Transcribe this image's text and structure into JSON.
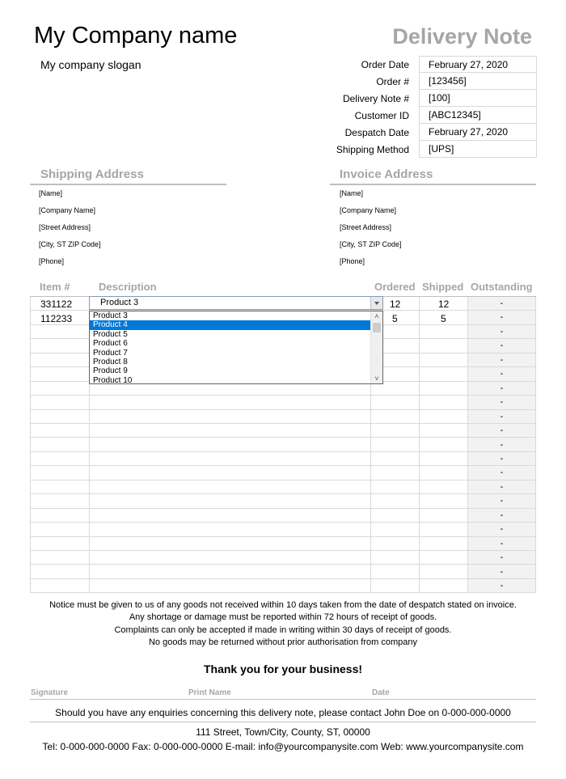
{
  "header": {
    "company_name": "My Company name",
    "slogan": "My company slogan",
    "doc_title": "Delivery Note"
  },
  "info": [
    {
      "label": "Order Date",
      "value": "February 27, 2020"
    },
    {
      "label": "Order #",
      "value": "[123456]"
    },
    {
      "label": "Delivery Note #",
      "value": "[100]"
    },
    {
      "label": "Customer ID",
      "value": "[ABC12345]"
    },
    {
      "label": "Despatch Date",
      "value": "February 27, 2020"
    },
    {
      "label": "Shipping Method",
      "value": "[UPS]"
    }
  ],
  "shipping": {
    "title": "Shipping Address",
    "lines": [
      "[Name]",
      "[Company Name]",
      "[Street Address]",
      "[City, ST  ZIP Code]",
      "[Phone]"
    ]
  },
  "invoice": {
    "title": "Invoice Address",
    "lines": [
      "[Name]",
      "[Company Name]",
      "[Street Address]",
      "[City, ST  ZIP Code]",
      "[Phone]"
    ]
  },
  "table": {
    "headers": {
      "item": "Item #",
      "description": "Description",
      "ordered": "Ordered",
      "shipped": "Shipped",
      "outstanding": "Outstanding"
    },
    "rows": [
      {
        "item": "331122",
        "description": "Product 3",
        "ordered": "12",
        "shipped": "12"
      },
      {
        "item": "112233",
        "description": "",
        "ordered": "5",
        "shipped": "5"
      }
    ],
    "dash": "-"
  },
  "dropdown": {
    "value": "Product 3",
    "options": [
      "Product 3",
      "Product 4",
      "Product 5",
      "Product 6",
      "Product 7",
      "Product 8",
      "Product 9",
      "Product 10"
    ],
    "selected": "Product 4"
  },
  "notice": [
    "Notice must be given to us of any goods not received within 10 days taken from the date of despatch stated on invoice.",
    "Any shortage or damage must be reported within 72 hours of receipt of goods.",
    "Complaints can only be accepted if made in writing within 30 days of receipt of goods.",
    "No goods may be returned without prior authorisation from company"
  ],
  "thanks": "Thank you for your business!",
  "signature": {
    "signature": "Signature",
    "print_name": "Print Name",
    "date": "Date"
  },
  "enquiry": "Should you have any enquiries concerning this delivery note, please contact John Doe on 0-000-000-0000",
  "footer": {
    "address": "111 Street, Town/City, County, ST, 00000",
    "contact": "Tel: 0-000-000-0000 Fax: 0-000-000-0000 E-mail: info@yourcompanysite.com Web: www.yourcompanysite.com"
  }
}
